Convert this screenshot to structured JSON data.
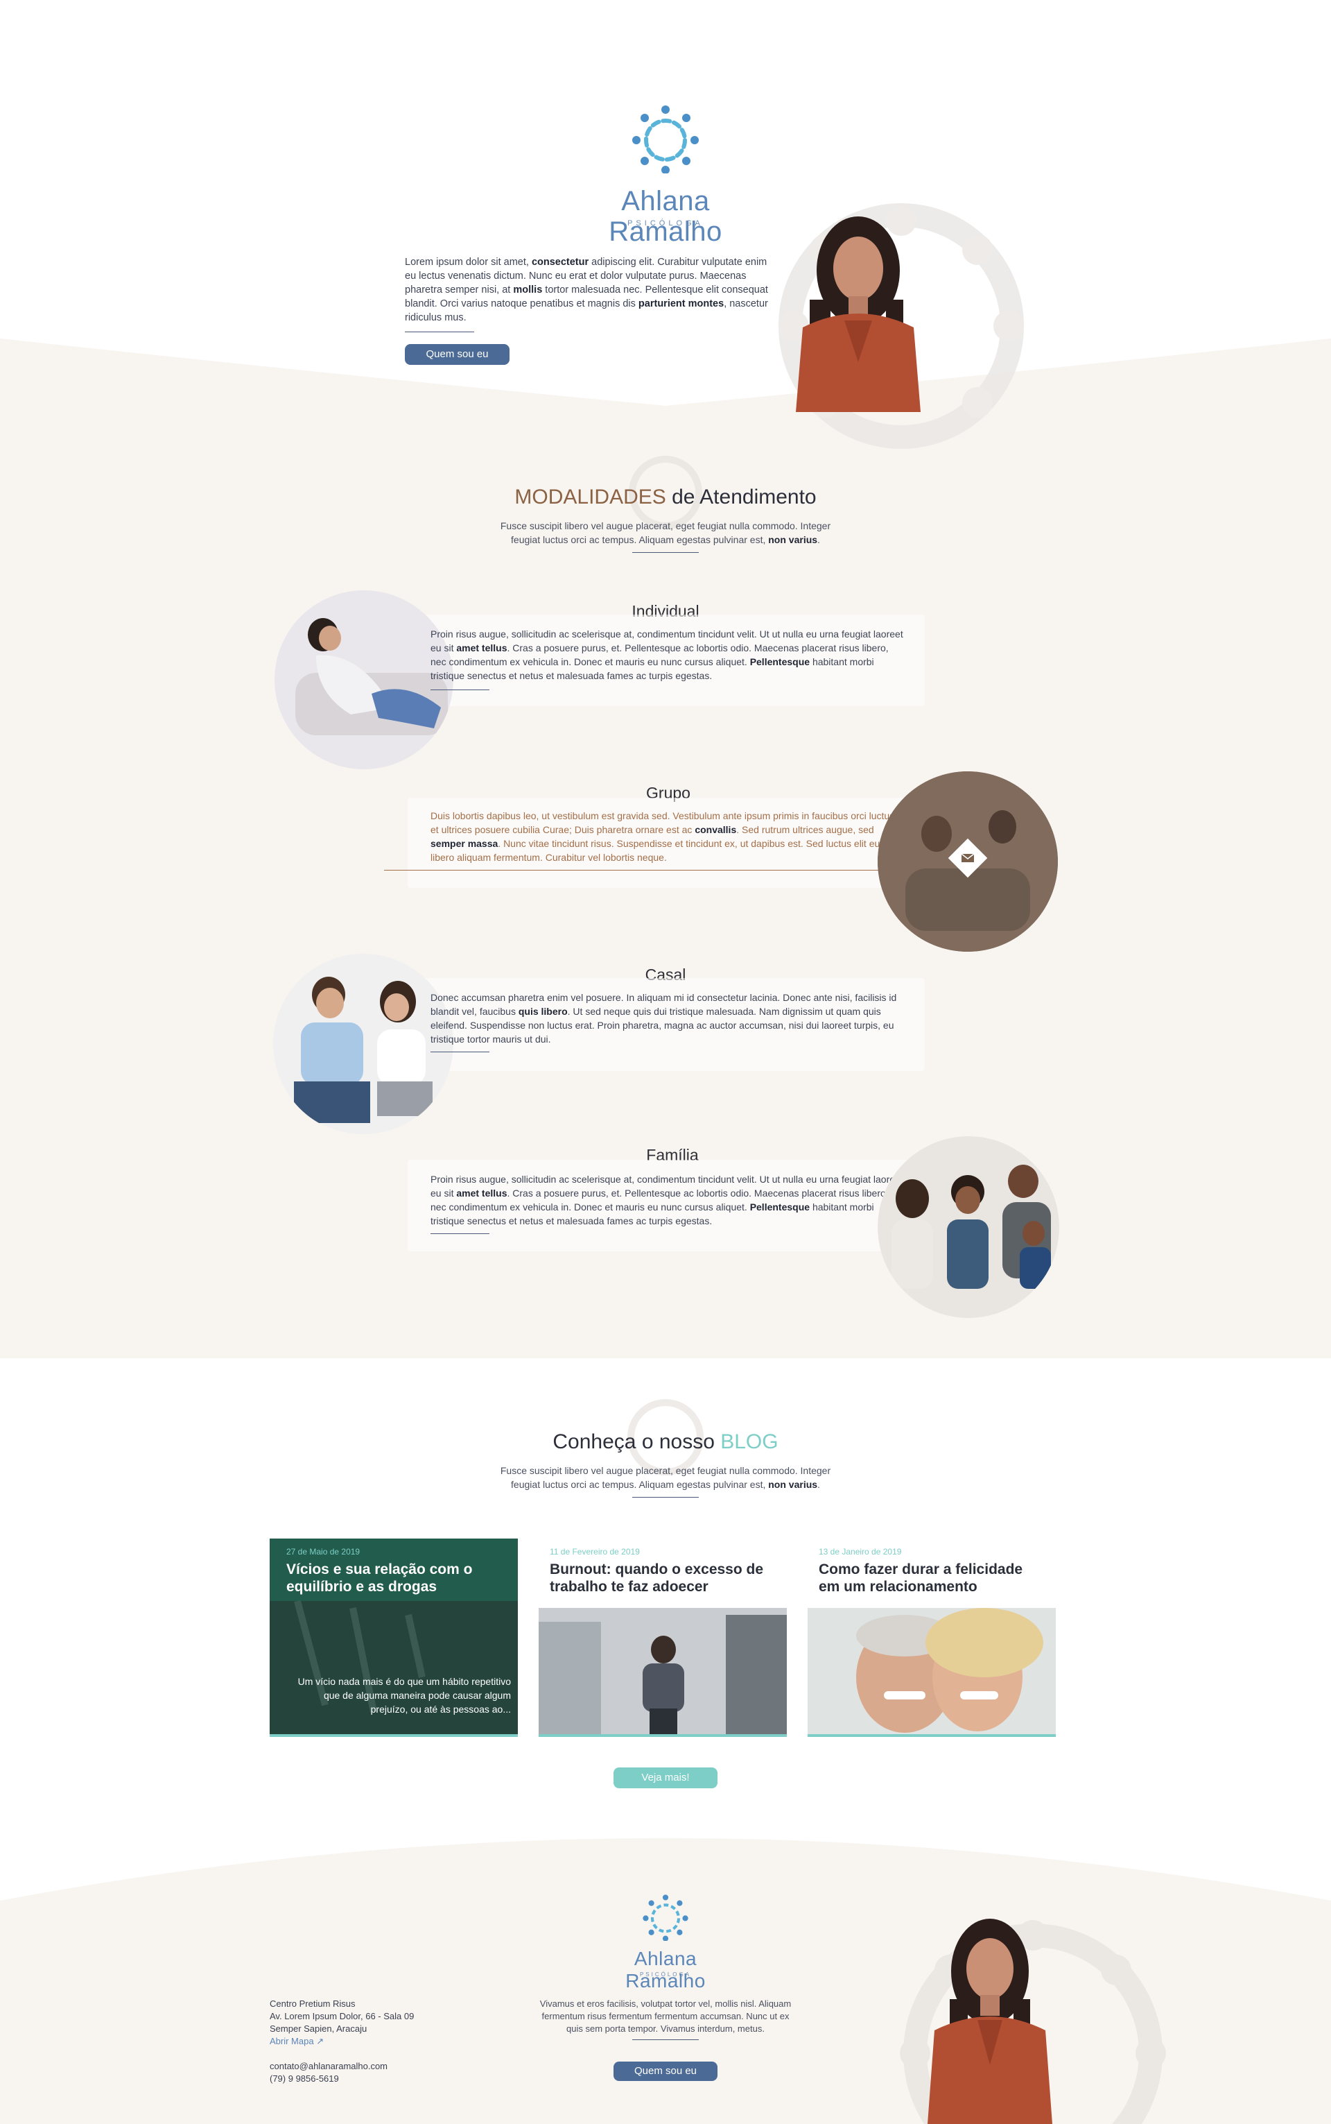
{
  "brand": {
    "name": "Ahlana Ramalho",
    "subtitle": "PSICÓLOGA"
  },
  "hero": {
    "paragraph_parts": [
      "Lorem ipsum dolor sit amet, ",
      "consectetur",
      " adipiscing elit. Curabitur vulputate enim eu lectus venenatis dictum. Nunc eu erat et dolor vulputate purus. Maecenas pharetra semper nisi, at ",
      "mollis",
      " tortor malesuada nec. Pellentesque elit consequat blandit. Orci varius natoque penatibus et magnis dis ",
      "parturient montes",
      ", nascetur ridiculus mus."
    ],
    "button_label": "Quem sou eu"
  },
  "modalidades": {
    "title_highlight": "MODALIDADES",
    "title_rest": " de Atendimento",
    "subtitle_plain": "Fusce suscipit libero vel augue placerat, eget feugiat nulla commodo. Integer feugiat luctus orci ac tempus. Aliquam egestas pulvinar est, ",
    "subtitle_bold": "non varius",
    "subtitle_end": ".",
    "items": [
      {
        "title": "Individual",
        "parts": [
          "Proin risus augue, sollicitudin ac scelerisque at, condimentum tincidunt velit. Ut ut nulla eu urna feugiat laoreet eu sit ",
          "amet tellus",
          ". Cras a posuere purus, et. Pellentesque ac lobortis odio. Maecenas placerat risus libero, nec condimentum ex vehicula in. Donec et mauris eu nunc cursus aliquet. ",
          "Pellentesque",
          " habitant morbi tristique senectus et netus et malesuada fames ac turpis egestas."
        ]
      },
      {
        "title": "Grupo",
        "parts": [
          "Duis lobortis dapibus leo, ut vestibulum est gravida sed. Vestibulum ante ipsum primis in faucibus orci luctus et ultrices posuere cubilia Curae; Duis pharetra ornare est ac ",
          "convallis",
          ". Sed rutrum ultrices augue, sed ",
          "semper massa",
          ". Nunc vitae tincidunt risus. Suspendisse et tincidunt ex, ut dapibus est. Sed luctus elit eu libero aliquam fermentum. Curabitur vel lobortis neque."
        ]
      },
      {
        "title": "Casal",
        "parts": [
          "Donec accumsan pharetra enim vel posuere. In aliquam mi id consectetur lacinia. Donec ante nisi, facilisis id blandit vel, faucibus ",
          "quis libero",
          ". Ut sed neque quis dui tristique malesuada. Nam dignissim ut quam quis eleifend. Suspendisse non luctus erat. Proin pharetra, magna ac auctor accumsan, nisi dui laoreet turpis, eu tristique tortor mauris ut dui."
        ]
      },
      {
        "title": "Família",
        "parts": [
          "Proin risus augue, sollicitudin ac scelerisque at, condimentum tincidunt velit. Ut ut nulla eu urna feugiat laoreet eu sit ",
          "amet tellus",
          ". Cras a posuere purus, et. Pellentesque ac lobortis odio. Maecenas placerat risus libero, nec condimentum ex vehicula in. Donec et mauris eu nunc cursus aliquet. ",
          "Pellentesque",
          " habitant morbi tristique senectus et netus et malesuada fames ac turpis egestas."
        ]
      }
    ]
  },
  "blog": {
    "title_plain": "Conheça o nosso ",
    "title_highlight": "BLOG",
    "subtitle_plain": "Fusce suscipit libero vel augue placerat, eget feugiat nulla commodo. Integer feugiat luctus orci ac tempus. Aliquam egestas pulvinar est, ",
    "subtitle_bold": "non varius",
    "subtitle_end": ".",
    "posts": [
      {
        "date": "27 de Maio de 2019",
        "title": "Vícios e sua relação com o equilíbrio e as drogas",
        "excerpt": "Um vício nada mais é do que um hábito repetitivo que de alguma maneira pode causar algum prejuízo, ou até às pessoas ao..."
      },
      {
        "date": "11 de Fevereiro de 2019",
        "title": "Burnout: quando o excesso de trabalho te faz adoecer"
      },
      {
        "date": "13 de Janeiro  de 2019",
        "title": "Como fazer durar a felicidade em um relacionamento"
      }
    ],
    "more_button": "Veja mais!"
  },
  "footer": {
    "address_lines": [
      "Centro  Pretium Risus",
      "Av. Lorem Ipsum Dolor, 66 - Sala 09",
      "Semper Sapien, Aracaju"
    ],
    "map_link": "Abrir Mapa",
    "email": "contato@ahlanaramalho.com",
    "phone": "(79) 9 9856-5619",
    "center_text": "Vivamus et eros facilisis, volutpat tortor vel, mollis nisl. Aliquam fermentum risus fermentum fermentum accumsan. Nunc ut ex quis sem porta tempor. Vivamus interdum, metus.",
    "button_label": "Quem sou eu"
  },
  "colors": {
    "brand_blue": "#5b86b9",
    "button_blue": "#4b6a95",
    "teal": "#7ccec6",
    "beige_bg": "#f8f4f0",
    "brown_accent": "#8b6243"
  }
}
